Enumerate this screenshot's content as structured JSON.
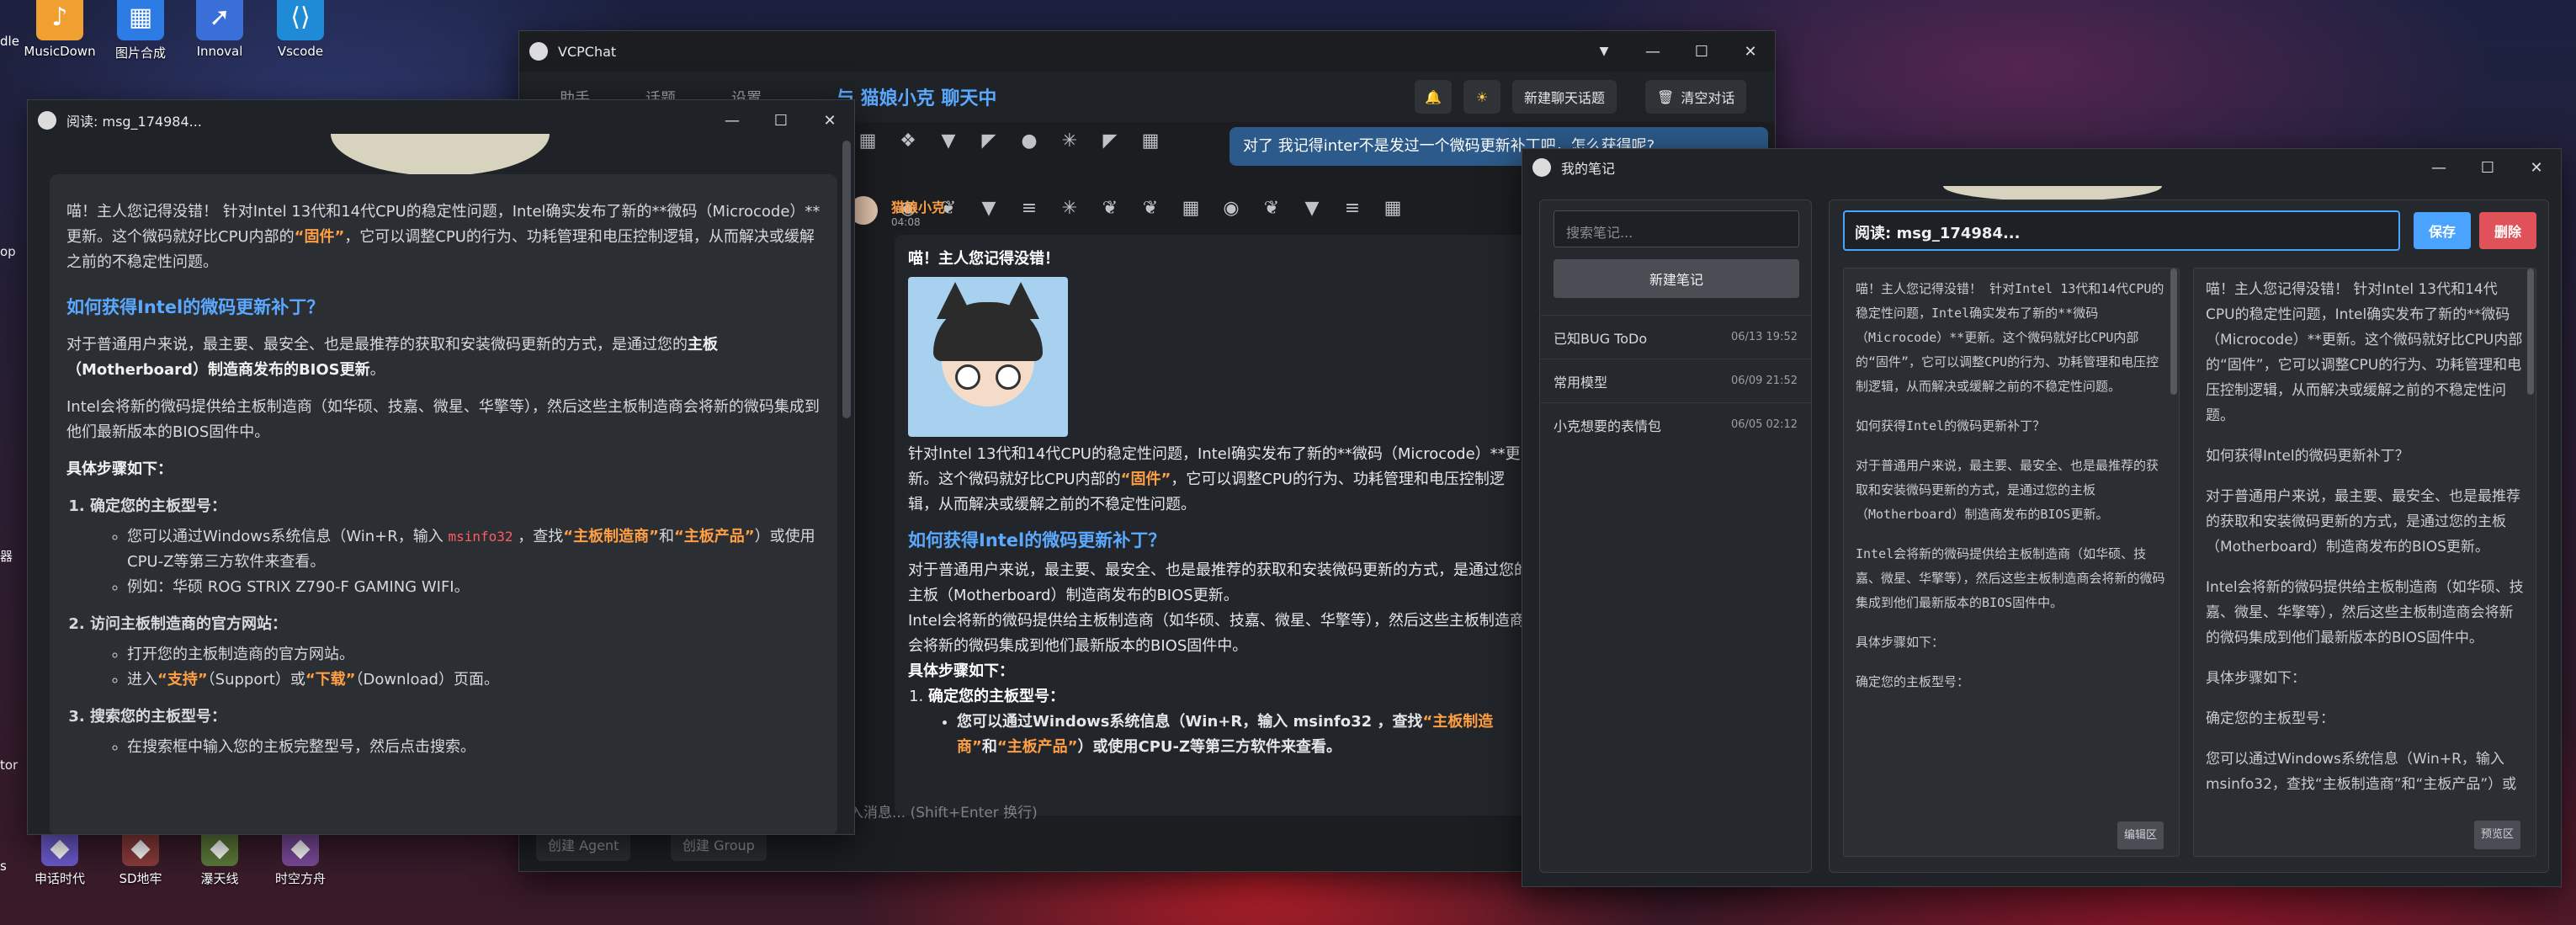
{
  "desktop": {
    "icons": [
      {
        "label": "MusicDown",
        "icon": "music-app-icon",
        "color": "#f0a030"
      },
      {
        "label": "图片合成",
        "icon": "image-compose-icon",
        "color": "#2d7be5"
      },
      {
        "label": "Innoval",
        "icon": "innoval-app-icon",
        "color": "#3a6fd8"
      },
      {
        "label": "Vscode",
        "icon": "vscode-icon",
        "color": "#1f8ad6"
      },
      {
        "label": "申话时代",
        "icon": "game-icon",
        "color": "#6a5acd"
      },
      {
        "label": "SD地牢",
        "icon": "game-icon",
        "color": "#8a3b3b"
      },
      {
        "label": "瀑天线",
        "icon": "game-icon",
        "color": "#5c7a3a"
      },
      {
        "label": "时空方舟",
        "icon": "game-icon",
        "color": "#7a4a9a"
      }
    ],
    "left_edge_labels": [
      "dle",
      "op",
      "器",
      "tor",
      "s"
    ]
  },
  "reader": {
    "title": "阅读: msg_174984...",
    "intro": "喵！主人您记得没错！ 针对Intel 13代和14代CPU的稳定性问题，Intel确实发布了新的**微码（Microcode）**更新。这个微码就好比CPU内部的",
    "intro_hl": "“固件”",
    "intro_tail": "，它可以调整CPU的行为、功耗管理和电压控制逻辑，从而解决或缓解之前的不稳定性问题。",
    "h_how": "如何获得Intel的微码更新补丁？",
    "p1_a": "对于普通用户来说，最主要、最安全、也是最推荐的获取和安装微码更新的方式，是通过您的",
    "p1_b": "主板（Motherboard）制造商发布的BIOS更新",
    "p1_c": "。",
    "p2": "Intel会将新的微码提供给主板制造商（如华硕、技嘉、微星、华擎等），然后这些主板制造商会将新的微码集成到他们最新版本的BIOS固件中。",
    "steps_title": "具体步骤如下：",
    "step1": "确定您的主板型号：",
    "step1_a1": "您可以通过Windows系统信息（Win+R，输入 ",
    "step1_code": "msinfo32",
    "step1_a2": " ，查找",
    "step1_hl1": "“主板制造商”",
    "step1_a3": "和",
    "step1_hl2": "“主板产品”",
    "step1_a4": "）或使用CPU-Z等第三方软件来查看。",
    "step1_b": "例如：华硕 ROG STRIX Z790-F GAMING WIFI。",
    "step2": "访问主板制造商的官方网站：",
    "step2_a": "打开您的主板制造商的官方网站。",
    "step2_b1": "进入",
    "step2_hl1": "“支持”",
    "step2_b2": "（Support）或",
    "step2_hl2": "“下载”",
    "step2_b3": "（Download）页面。",
    "step3": "搜索您的主板型号：",
    "step3_a": "在搜索框中输入您的主板完整型号，然后点击搜索。"
  },
  "chat": {
    "title": "VCPChat",
    "tabs": [
      "助手",
      "话题",
      "设置"
    ],
    "header_title": "与 猫娘小克 聊天中",
    "new_topic": "新建聊天话题",
    "clear": "清空对话",
    "user_msg": "对了 我记得inter不是发过一个微码更新补丁吧，怎么获得呢?",
    "sender": "猫娘小克",
    "time": "04:08",
    "reply_greet": "喵！主人您记得没错！",
    "reply_p1": "针对Intel 13代和14代CPU的稳定性问题，Intel确实发布了新的**微码（Microcode）**更新。这个微码就好比CPU内部的",
    "reply_hl": "“固件”",
    "reply_p1_tail": "，它可以调整CPU的行为、功耗管理和电压控制逻辑，从而解决或缓解之前的不稳定性问题。",
    "reply_h": "如何获得Intel的微码更新补丁？",
    "reply_p2": "对于普通用户来说，最主要、最安全、也是最推荐的获取和安装微码更新的方式，是通过您的主板（Motherboard）制造商发布的BIOS更新。",
    "reply_p3": "Intel会将新的微码提供给主板制造商（如华硕、技嘉、微星、华擎等），然后这些主板制造商会将新的微码集成到他们最新版本的BIOS固件中。",
    "reply_steps": "具体步骤如下：",
    "reply_step1": "确定您的主板型号：",
    "reply_step1_a": "您可以通过Windows系统信息（Win+R，输入 msinfo32 ，查找",
    "reply_step1_hl1": "“主板制造商”",
    "reply_step1_b": "和",
    "reply_step1_hl2": "“主板产品”",
    "reply_step1_c": "）或使用CPU-Z等第三方软件来查看。",
    "input_placeholder": "入消息... (Shift+Enter 换行)",
    "create_agent": "创建 Agent",
    "create_group": "创建 Group"
  },
  "notes": {
    "title": "我的笔记",
    "search_placeholder": "搜索笔记...",
    "new_note": "新建笔记",
    "items": [
      {
        "name": "已知BUG ToDo",
        "date": "06/13 19:52"
      },
      {
        "name": "常用模型",
        "date": "06/09 21:52"
      },
      {
        "name": "小克想要的表情包",
        "date": "06/05 02:12"
      }
    ],
    "title_value": "阅读: msg_174984...",
    "save": "保存",
    "delete": "删除",
    "edit_pane": [
      "喵！主人您记得没错！ 针对Intel 13代和14代CPU的稳定性问题，Intel确实发布了新的**微码（Microcode）**更新。这个微码就好比CPU内部的“固件”，它可以调整CPU的行为、功耗管理和电压控制逻辑，从而解决或缓解之前的不稳定性问题。",
      "如何获得Intel的微码更新补丁？",
      "对于普通用户来说，最主要、最安全、也是最推荐的获取和安装微码更新的方式，是通过您的主板（Motherboard）制造商发布的BIOS更新。",
      "Intel会将新的微码提供给主板制造商（如华硕、技嘉、微星、华擎等），然后这些主板制造商会将新的微码集成到他们最新版本的BIOS固件中。",
      "具体步骤如下：",
      "确定您的主板型号："
    ],
    "edit_badge": "编辑区",
    "preview_pane": [
      "喵！主人您记得没错！ 针对Intel 13代和14代CPU的稳定性问题，Intel确实发布了新的**微码（Microcode）**更新。这个微码就好比CPU内部的“固件”，它可以调整CPU的行为、功耗管理和电压控制逻辑，从而解决或缓解之前的不稳定性问题。",
      "如何获得Intel的微码更新补丁？",
      "对于普通用户来说，最主要、最安全、也是最推荐的获取和安装微码更新的方式，是通过您的主板（Motherboard）制造商发布的BIOS更新。",
      "Intel会将新的微码提供给主板制造商（如华硕、技嘉、微星、华擎等），然后这些主板制造商会将新的微码集成到他们最新版本的BIOS固件中。",
      "具体步骤如下：",
      "确定您的主板型号：",
      "您可以通过Windows系统信息（Win+R，输入 msinfo32，查找“主板制造商”和“主板产品”）或"
    ],
    "preview_badge": "预览区"
  },
  "colors": {
    "accent_blue": "#5aa9ff",
    "highlight_orange": "#ff9f43",
    "save_blue": "#4aa3ff",
    "delete_red": "#e0525a"
  }
}
